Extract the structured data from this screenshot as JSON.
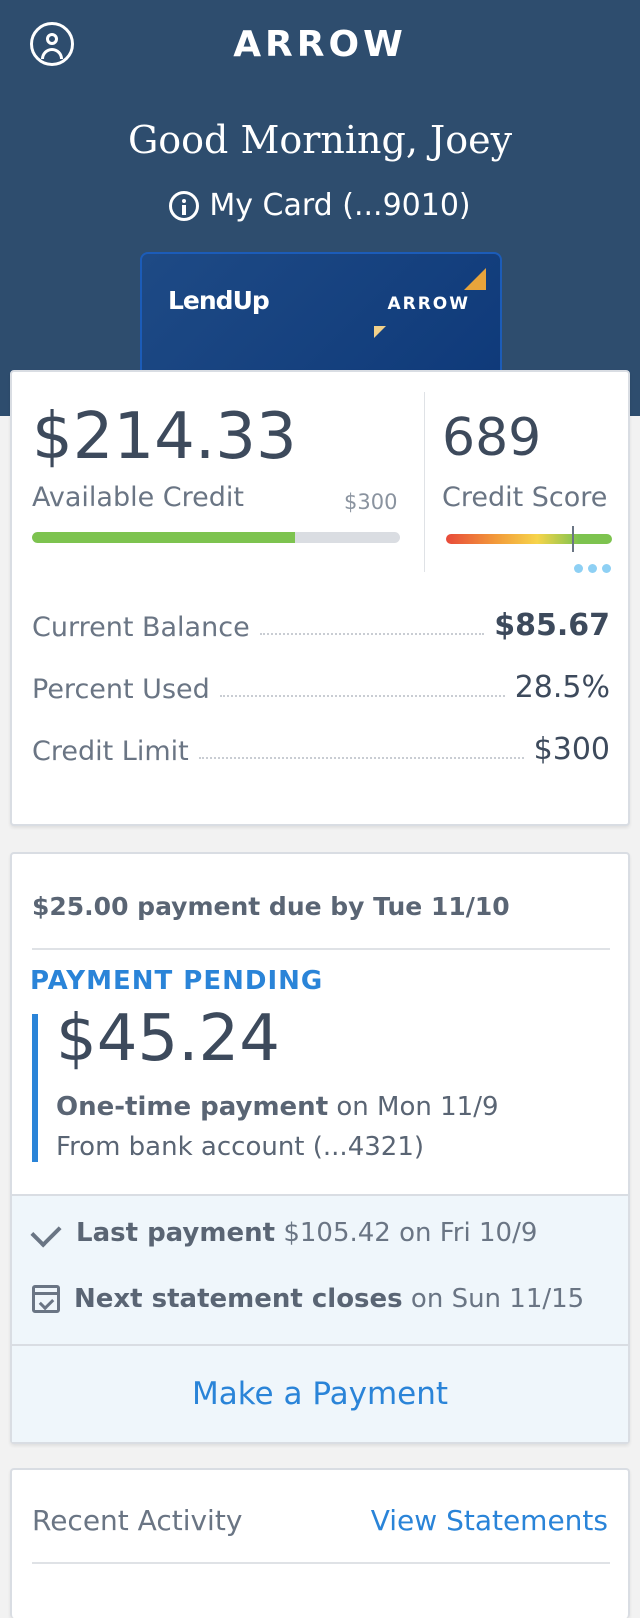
{
  "header": {
    "brand": "ARROW",
    "greeting": "Good Morning, Joey",
    "my_card": "My Card (...9010)"
  },
  "card_image": {
    "issuer_logo": "LendUp",
    "brand": "ARROW"
  },
  "credit": {
    "available_amount": "$214.33",
    "available_label": "Available Credit",
    "limit_small": "$300",
    "available_fraction": 0.714,
    "score": "689",
    "score_label": "Credit Score",
    "score_position": 0.76,
    "details": [
      {
        "label": "Current Balance",
        "value": "$85.67"
      },
      {
        "label": "Percent Used",
        "value": "28.5%"
      },
      {
        "label": "Credit Limit",
        "value": "$300"
      }
    ]
  },
  "payment": {
    "due_text": "$25.00 payment due by Tue 11/10",
    "pending_label": "PAYMENT PENDING",
    "pending_amount": "$45.24",
    "pending_type": "One-time payment",
    "pending_date": "on Mon 11/9",
    "pending_source": "From bank account (...4321)",
    "last_payment_label": "Last payment",
    "last_payment_detail": "$105.42 on Fri 10/9",
    "next_statement_label": "Next statement closes",
    "next_statement_detail": "on Sun 11/15",
    "make_payment": "Make a Payment"
  },
  "activity": {
    "title": "Recent Activity",
    "view_statements": "View Statements"
  },
  "colors": {
    "header_bg": "#2e4d6e",
    "accent_blue": "#2a84d8",
    "bar_green": "#7dc34f"
  },
  "icons": [
    "profile-icon",
    "info-icon",
    "more-dots-icon",
    "checkmark-icon",
    "calendar-check-icon"
  ]
}
